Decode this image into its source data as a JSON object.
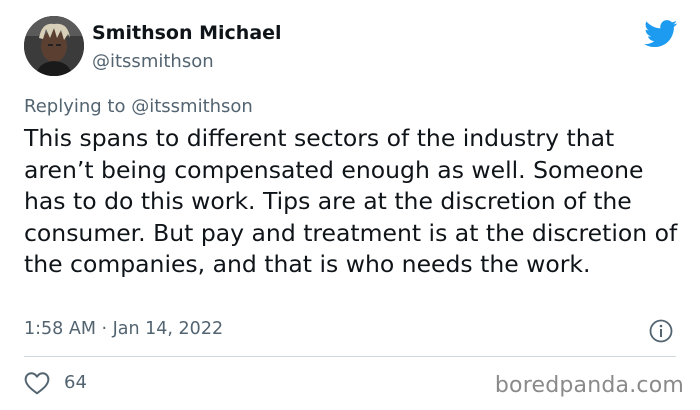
{
  "author": {
    "display_name": "Smithson Michael",
    "handle": "@itssmithson"
  },
  "reply": {
    "prefix": "Replying to",
    "mention": "@itssmithson"
  },
  "tweet": {
    "text": "This spans to different sectors of the industry that aren’t being compensated enough as well. Someone has to do this work. Tips are at the discretion of the consumer. But pay and treatment is at the discretion of the companies, and that is who needs the work.",
    "timestamp": "1:58 AM · Jan 14, 2022"
  },
  "engagement": {
    "likes": "64"
  },
  "watermark": "boredpanda.com",
  "icons": {
    "brand": "twitter-bird-icon",
    "info": "info-icon",
    "like": "heart-icon"
  },
  "colors": {
    "twitter_blue": "#1d9bf0",
    "text_primary": "#0f1419",
    "text_secondary": "#536471",
    "divider": "#cfd9de",
    "watermark": "#8a8a8a"
  }
}
